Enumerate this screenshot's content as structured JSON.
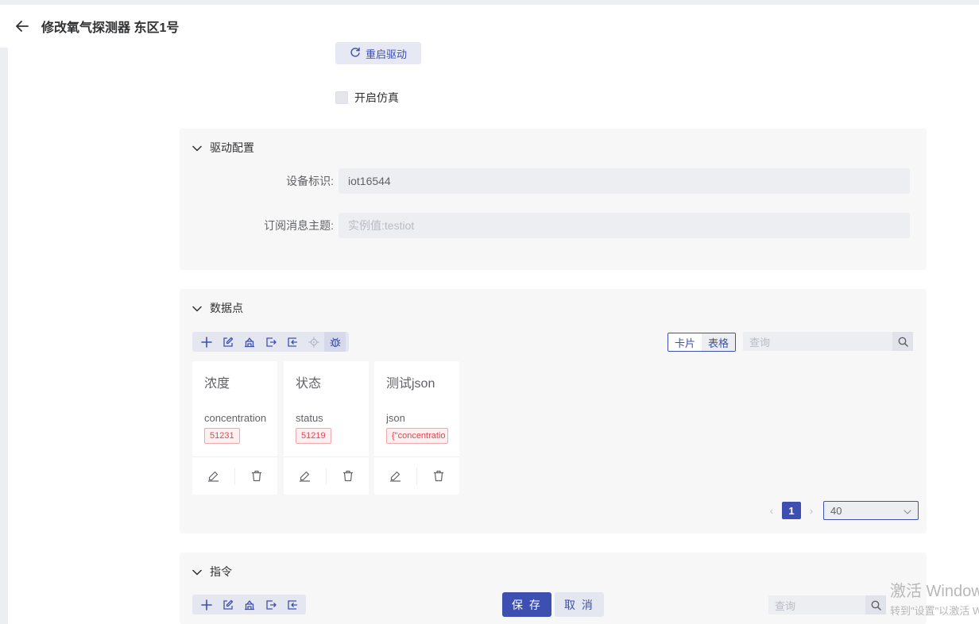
{
  "header": {
    "title": "修改氧气探测器 东区1号"
  },
  "restart_label": "重启驱动",
  "simulation_label": "开启仿真",
  "driver_config": {
    "title": "驱动配置",
    "fields": [
      {
        "label": "设备标识:",
        "value": "iot16544",
        "placeholder": ""
      },
      {
        "label": "订阅消息主题:",
        "value": "",
        "placeholder": "实例值:testiot"
      }
    ]
  },
  "datapoints": {
    "title": "数据点",
    "view_options": [
      "卡片",
      "表格"
    ],
    "search_placeholder": "查询",
    "cards": [
      {
        "title": "浓度",
        "key": "concentration",
        "value": "51231"
      },
      {
        "title": "状态",
        "key": "status",
        "value": "51219"
      },
      {
        "title": "测试json",
        "key": "json",
        "value": "{\"concentratio"
      }
    ],
    "pagination": {
      "current_page": "1",
      "page_size": "40"
    }
  },
  "commands": {
    "title": "指令",
    "search_placeholder": "查询"
  },
  "footer": {
    "save_label": "保 存",
    "cancel_label": "取 消"
  },
  "watermark": {
    "line1": "激活 Windows",
    "line2": "转到\"设置\"以激活 Windows。"
  },
  "colors": {
    "primary": "#3d4fb0",
    "danger": "#e8434e",
    "panel_bg": "#f7f7f7"
  }
}
